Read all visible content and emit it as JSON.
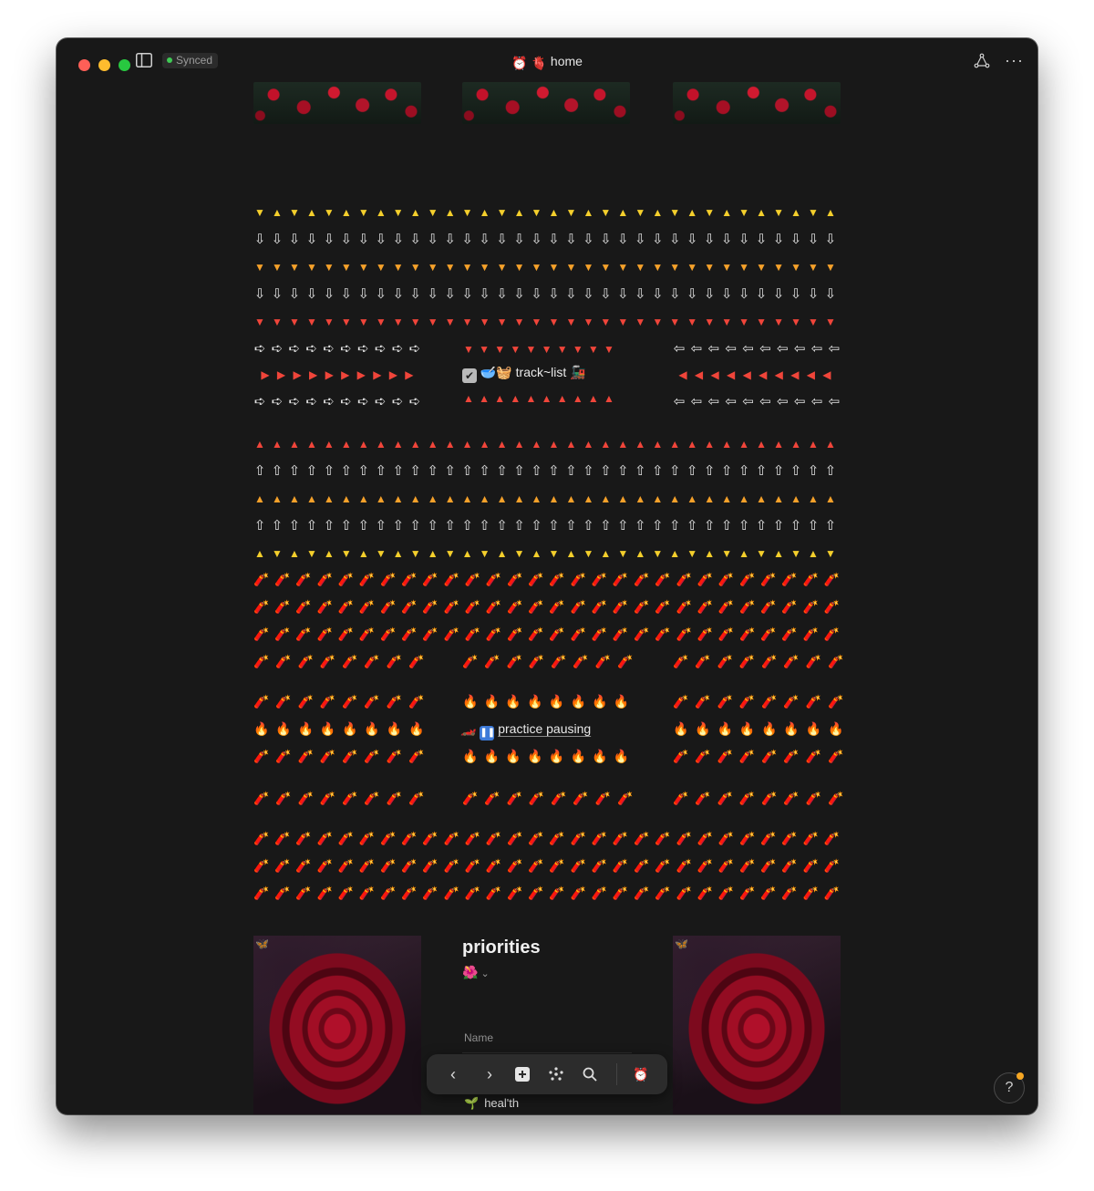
{
  "window": {
    "status_badge": "Synced",
    "title": "home",
    "title_icons": [
      "alarm-clock-icon",
      "anatomical-heart-icon"
    ]
  },
  "pattern_rows": {
    "tri_yellow_alt": "▼▲",
    "arrow_down": "⇩",
    "tri_orange_down": "▼",
    "tri_red_down": "▼",
    "arrow_right": "➪",
    "tri_red_right": "▶",
    "arrow_left": "⇦",
    "tri_red_left": "◀",
    "tri_red_up": "▲",
    "arrow_up": "⇧",
    "tri_orange_up": "▲",
    "firecracker": "🧨",
    "fire": "🔥"
  },
  "blocks": {
    "track_list": {
      "label": "track~list",
      "icons": [
        "check-box-icon",
        "bowl-icon",
        "mat-icon",
        "train-icon"
      ]
    },
    "practice_pausing": {
      "label": "practice pausing",
      "icons": [
        "car-icon",
        "pause-icon"
      ]
    }
  },
  "priorities": {
    "title": "priorities",
    "icon": "hibiscus-icon",
    "column_header": "Name",
    "rows": [
      {
        "label": "heal'th",
        "icon": "seedling-icon"
      }
    ]
  },
  "toolbar": {
    "items": [
      "back-icon",
      "forward-icon",
      "new-page-icon",
      "graph-icon",
      "search-icon",
      "alarm-clock-icon"
    ]
  },
  "help": "?",
  "colors": {
    "background": "#181818",
    "yellow": "#f4cf2c",
    "orange": "#f5a12a",
    "red": "#f0453a",
    "accent_dot": "#f5a623"
  }
}
